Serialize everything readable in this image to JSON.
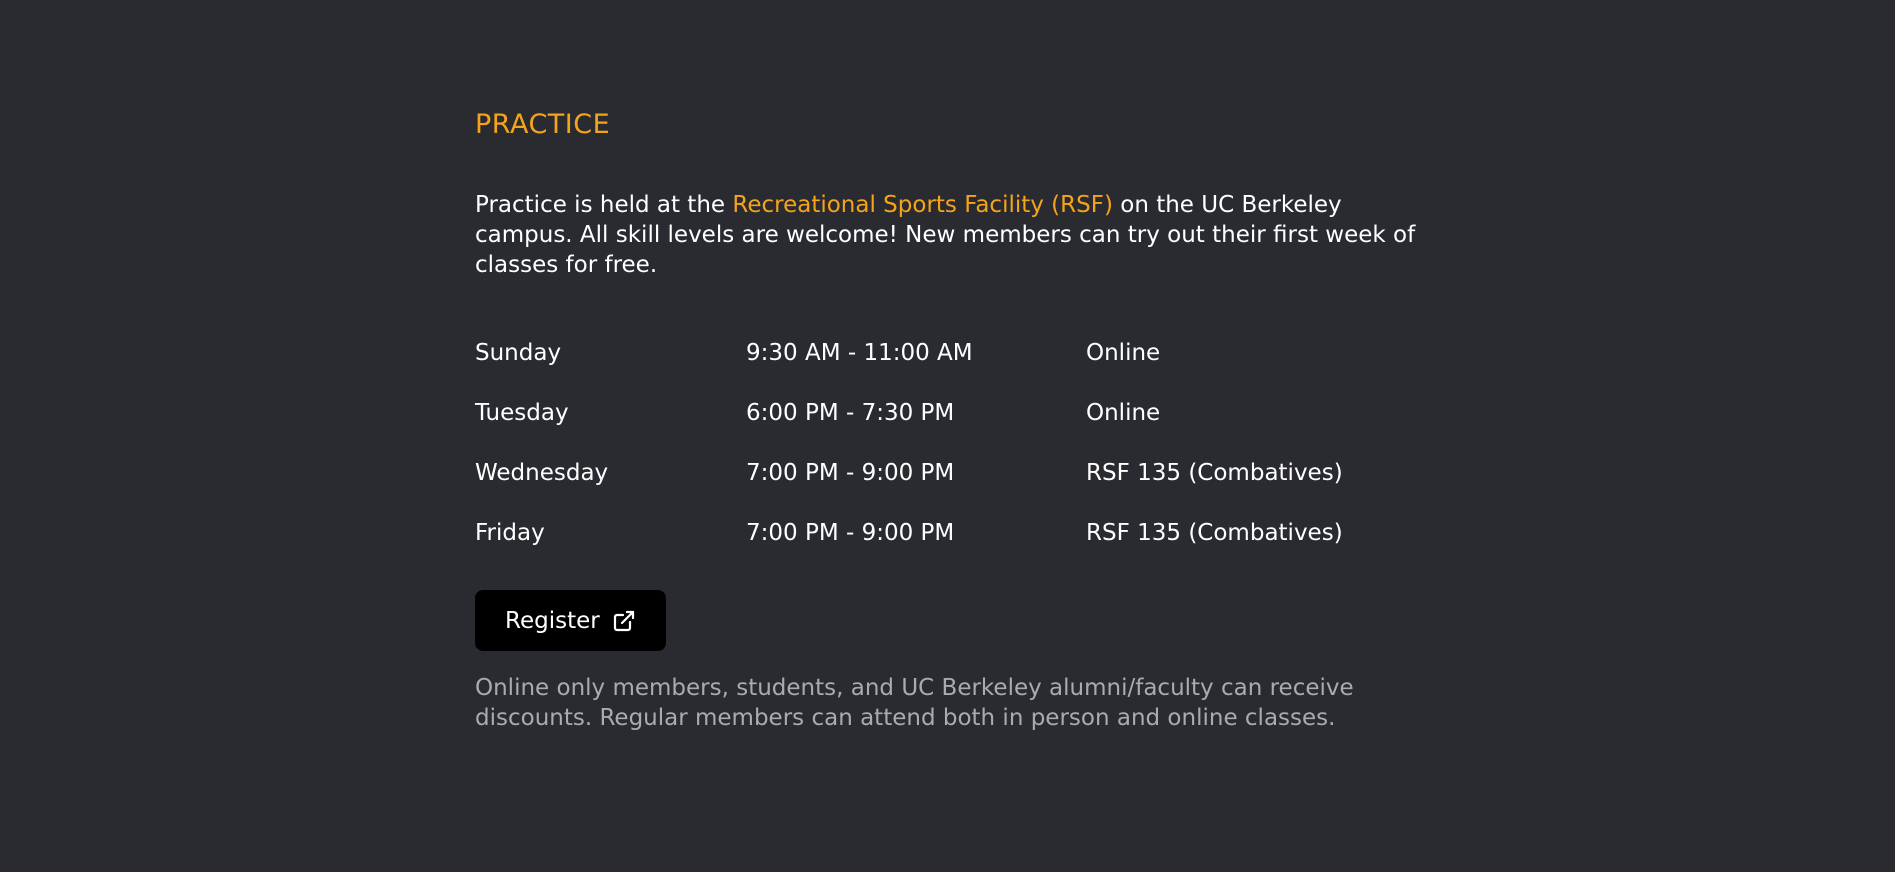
{
  "practice": {
    "heading": "PRACTICE",
    "intro_before": "Practice is held at the ",
    "intro_link": "Recreational Sports Facility (RSF)",
    "intro_after": " on the UC Berkeley campus. All skill levels are welcome! New members can try out their first week of classes for free.",
    "schedule": [
      {
        "day": "Sunday",
        "time": "9:30 AM - 11:00 AM",
        "location": "Online"
      },
      {
        "day": "Tuesday",
        "time": "6:00 PM - 7:30 PM",
        "location": "Online"
      },
      {
        "day": "Wednesday",
        "time": "7:00 PM - 9:00 PM",
        "location": "RSF 135 (Combatives)"
      },
      {
        "day": "Friday",
        "time": "7:00 PM - 9:00 PM",
        "location": "RSF 135 (Combatives)"
      }
    ],
    "register_label": "Register",
    "register_icon": "external-link-icon",
    "note": "Online only members, students, and UC Berkeley alumni/faculty can receive discounts. Regular members can attend both in person and online classes."
  },
  "colors": {
    "background": "#292b30",
    "accent": "#f5a41a",
    "text": "#ffffff",
    "muted": "#a9abaf",
    "button": "#000000"
  }
}
